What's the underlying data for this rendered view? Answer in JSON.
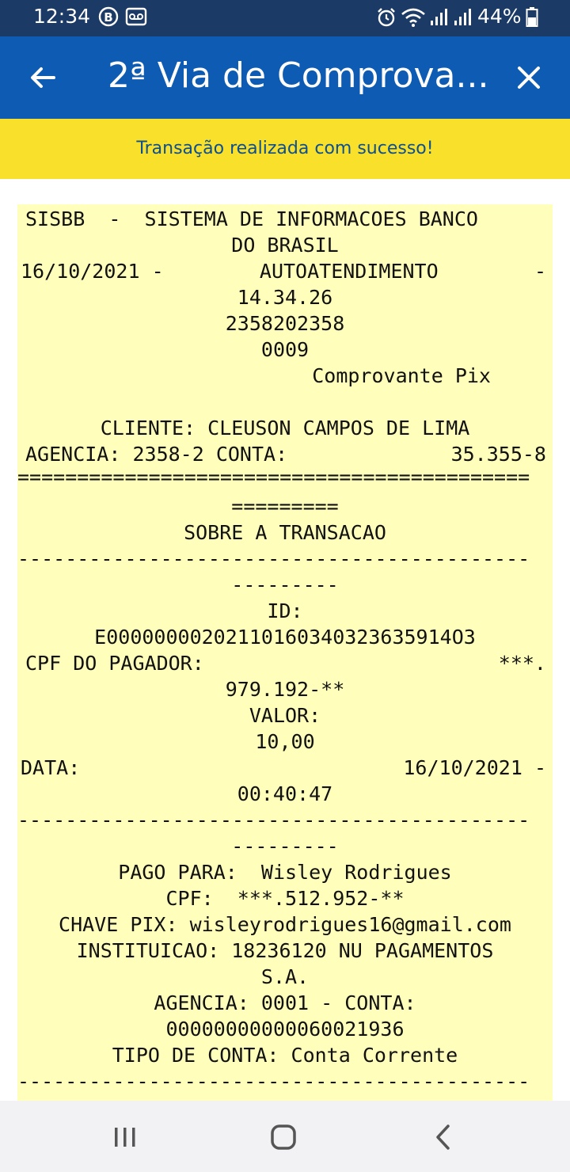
{
  "status_bar": {
    "time": "12:34",
    "battery": "44%"
  },
  "app_bar": {
    "title": "2ª Via de Comprova..."
  },
  "banner": {
    "message": "Transação realizada com sucesso!"
  },
  "receipt": {
    "header1": "SISBB  -  SISTEMA DE INFORMACOES BANCO",
    "header2": "DO BRASIL",
    "date": "16/10/2021 -",
    "channel": "AUTOATENDIMENTO",
    "channel_dash": "-",
    "time": "14.34.26",
    "terminal": "2358202358",
    "seq": "0009",
    "doc_type": "Comprovante Pix",
    "client": "CLIENTE: CLEUSON CAMPOS DE LIMA",
    "agency_label": "AGENCIA: 2358-2 CONTA:",
    "account": "35.355-8",
    "sep_eq_1": "===========================================",
    "sep_eq_2": "=========",
    "section_title": "SOBRE A TRANSACAO",
    "sep_dash_1": "-------------------------------------------",
    "sep_dash_2": "---------",
    "id_label": "ID:",
    "id_value": "E00000000202110160340323635914O3",
    "payer_cpf_label": "CPF DO PAGADOR:",
    "payer_cpf_mask": "***.",
    "payer_cpf_rest": "979.192-**",
    "value_label": "VALOR:",
    "value": "10,00",
    "date_label": "DATA:",
    "date_value": "16/10/2021 -",
    "date_time": "00:40:47",
    "sep_dash_3": "-------------------------------------------",
    "sep_dash_4": "---------",
    "paid_to": "PAGO PARA:  Wisley Rodrigues",
    "payee_cpf": "CPF:  ***.512.952-**",
    "pix_key": "CHAVE PIX: wisleyrodrigues16@gmail.com",
    "institution": "INSTITUICAO: 18236120 NU PAGAMENTOS",
    "institution2": "S.A.",
    "payee_agency": "AGENCIA: 0001 - CONTA:",
    "payee_account": "00000000000060021936",
    "account_type": "TIPO DE CONTA: Conta Corrente",
    "sep_dash_5": "-------------------------------------------"
  },
  "colors": {
    "status_bar_bg": "#1b3a66",
    "app_bar_bg": "#0d5bb3",
    "banner_bg": "#f9e02a",
    "banner_text": "#0d4f8f",
    "receipt_bg": "#ffffbb"
  },
  "icons": {
    "back": "arrow-left-icon",
    "close": "close-icon",
    "recents": "recent-apps-icon",
    "home": "home-icon",
    "nav_back": "chevron-left-icon"
  }
}
